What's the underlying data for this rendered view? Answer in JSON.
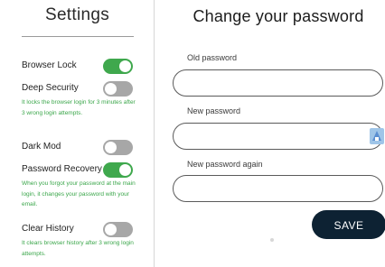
{
  "sidebar": {
    "title": "Settings",
    "items": [
      {
        "label": "Browser Lock",
        "enabled": true,
        "description": ""
      },
      {
        "label": "Deep Security",
        "enabled": false,
        "description": "It locks the browser login for 3 minutes after 3 wrong login attempts."
      },
      {
        "label": "Dark Mod",
        "enabled": false,
        "description": ""
      },
      {
        "label": "Password Recovery",
        "enabled": true,
        "description": "When you forgot your password at the main login, it changes your password with your email."
      },
      {
        "label": "Clear History",
        "enabled": false,
        "description": "It clears browser history after 3 wrong login attempts."
      }
    ]
  },
  "main": {
    "title": "Change your password",
    "fields": [
      {
        "label": "Old password",
        "value": ""
      },
      {
        "label": "New password",
        "value": ""
      },
      {
        "label": "New password again",
        "value": ""
      }
    ],
    "save_label": "SAVE"
  },
  "colors": {
    "toggle_on": "#3fa84d",
    "toggle_off": "#a7a7a7",
    "description_text": "#3aa64a",
    "save_button": "#0d2233"
  },
  "icons": {
    "field_icon": "key-icon"
  }
}
